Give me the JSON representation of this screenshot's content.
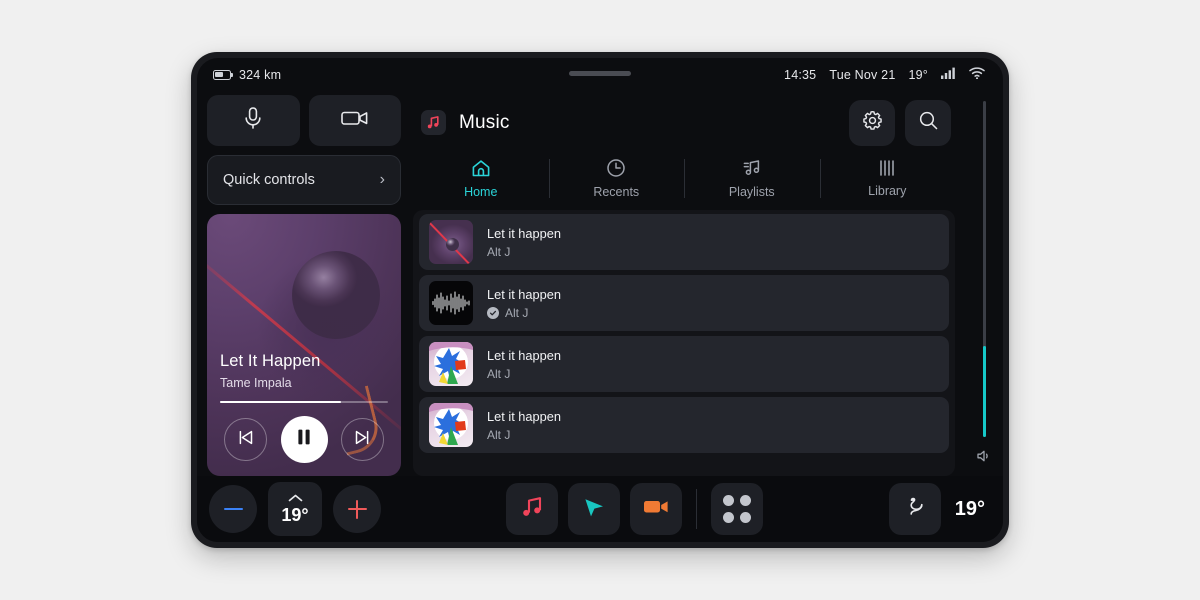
{
  "status_bar": {
    "range": "324 km",
    "time": "14:35",
    "date": "Tue Nov 21",
    "temperature": "19°",
    "battery_icon": "battery-icon",
    "signal_icon": "signal-bars-icon",
    "wifi_icon": "wifi-icon"
  },
  "left_panel": {
    "mic_icon": "microphone-icon",
    "camera_icon": "video-camera-icon",
    "quick_controls_label": "Quick controls",
    "chevron": "›",
    "now_playing": {
      "title": "Let It Happen",
      "artist": "Tame Impala",
      "progress_percent": 72,
      "prev_icon": "skip-previous-icon",
      "play_state_icon": "pause-icon",
      "next_icon": "skip-next-icon"
    }
  },
  "app": {
    "title": "Music",
    "app_icon": "music-note-icon",
    "settings_icon": "gear-icon",
    "search_icon": "search-icon",
    "tabs": [
      {
        "label": "Home",
        "icon": "home-icon",
        "active": true
      },
      {
        "label": "Recents",
        "icon": "clock-icon",
        "active": false
      },
      {
        "label": "Playlists",
        "icon": "playlist-note-icon",
        "active": false
      },
      {
        "label": "Library",
        "icon": "library-bars-icon",
        "active": false
      }
    ],
    "tracks": [
      {
        "title": "Let it happen",
        "artist": "Alt J",
        "artwork": "purple-streak-artwork",
        "verified": false
      },
      {
        "title": "Let it happen",
        "artist": "Alt J",
        "artwork": "waveform-artwork",
        "verified": true
      },
      {
        "title": "Let it happen",
        "artist": "Alt J",
        "artwork": "paint-splash-artwork",
        "verified": false
      },
      {
        "title": "Let it happen",
        "artist": "Alt J",
        "artwork": "paint-splash-artwork",
        "verified": false
      }
    ]
  },
  "volume": {
    "level_percent": 27,
    "speaker_icon": "speaker-icon"
  },
  "dock": {
    "temp_down_icon": "minus-icon",
    "temp_up_icon": "plus-icon",
    "driver_temp": "19°",
    "fan_direction_icon": "chevron-up-icon",
    "apps": [
      {
        "name": "music-app",
        "icon": "music-note-icon"
      },
      {
        "name": "navigation-app",
        "icon": "navigation-arrow-icon"
      },
      {
        "name": "camera-app",
        "icon": "video-camera-icon"
      },
      {
        "name": "all-apps",
        "icon": "app-grid-icon"
      }
    ],
    "seat_icon": "seat-heater-icon",
    "passenger_temp": "19°"
  },
  "colors": {
    "accent": "#2ad4d8",
    "volume_fill": "#16c9c9",
    "minus": "#3b82f6",
    "plus": "#f05a5a",
    "music_red": "#f0445a",
    "nav_teal": "#19c6c0",
    "camera_orange": "#f07a34"
  }
}
